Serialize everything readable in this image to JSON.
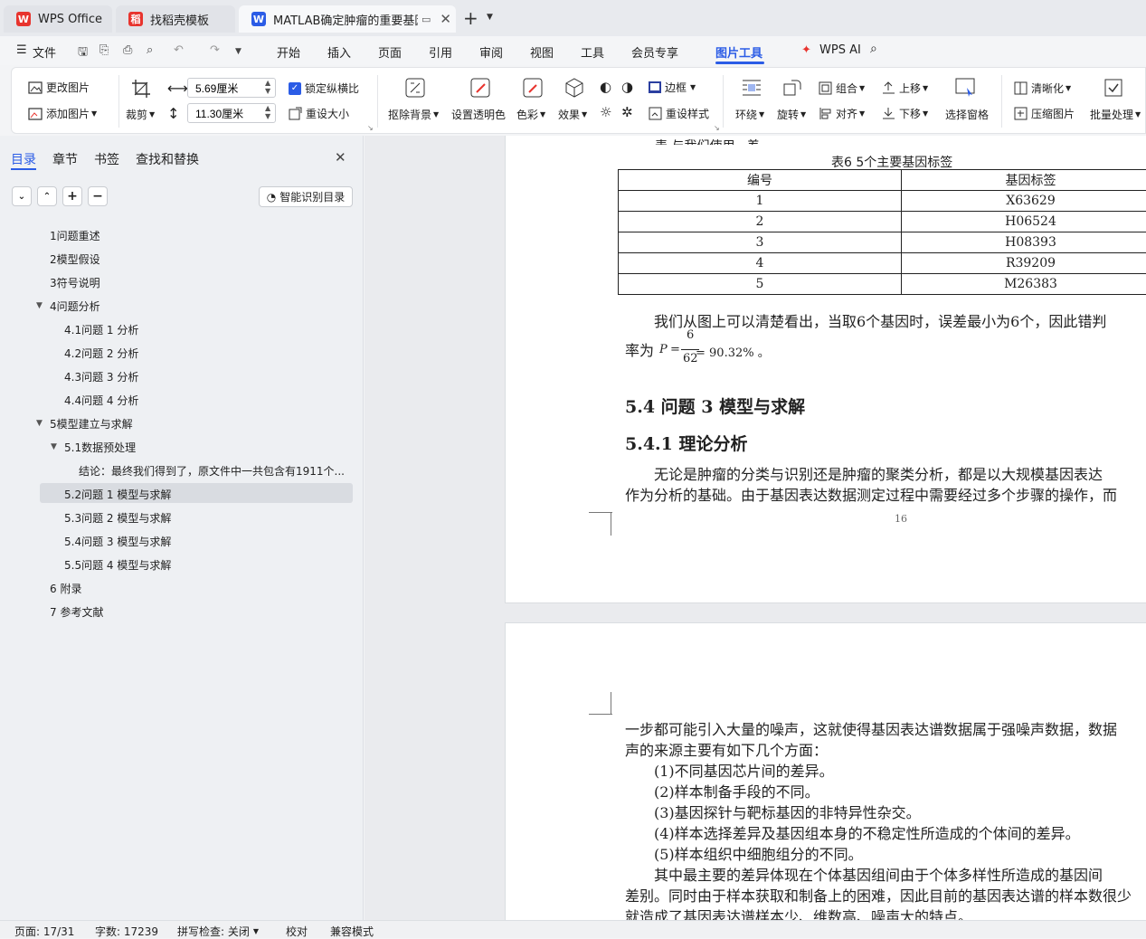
{
  "tabs": [
    {
      "label": "WPS Office",
      "icon": "wps-logo-icon"
    },
    {
      "label": "找稻壳模板",
      "icon": "docer-icon"
    },
    {
      "label": "MATLAB确定肿瘤的重要基因",
      "icon": "writer-doc-icon"
    }
  ],
  "menu": {
    "file": "文件",
    "items": [
      "开始",
      "插入",
      "页面",
      "引用",
      "审阅",
      "视图",
      "工具",
      "会员专享",
      "图片工具"
    ],
    "active": "图片工具",
    "ai": "WPS AI"
  },
  "ribbon": {
    "change_image": "更改图片",
    "add_image": "添加图片",
    "crop": "裁剪",
    "width": "5.69厘米",
    "height": "11.30厘米",
    "lock_ratio": "锁定纵横比",
    "reset_size": "重设大小",
    "remove_bg": "抠除背景",
    "set_transparent": "设置透明色",
    "color": "色彩",
    "effect": "效果",
    "border": "边框",
    "reset_style": "重设样式",
    "wrap": "环绕",
    "rotate": "旋转",
    "group": "组合",
    "align": "对齐",
    "bring_forward": "上移",
    "send_backward": "下移",
    "selection_pane": "选择窗格",
    "sharpen": "清晰化",
    "compress": "压缩图片",
    "batch": "批量处理"
  },
  "sidebar": {
    "tabs": [
      "目录",
      "章节",
      "书签",
      "查找和替换"
    ],
    "smart_toc": "智能识别目录",
    "toc": [
      {
        "label": "1问题重述",
        "level": 1
      },
      {
        "label": "2模型假设",
        "level": 1
      },
      {
        "label": "3符号说明",
        "level": 1
      },
      {
        "label": "4问题分析",
        "level": 1,
        "expanded": true
      },
      {
        "label": "4.1问题 1 分析",
        "level": 2
      },
      {
        "label": "4.2问题 2 分析",
        "level": 2
      },
      {
        "label": "4.3问题 3 分析",
        "level": 2
      },
      {
        "label": "4.4问题 4 分析",
        "level": 2
      },
      {
        "label": "5模型建立与求解",
        "level": 1,
        "expanded": true
      },
      {
        "label": "5.1数据预处理",
        "level": 2,
        "expanded": true
      },
      {
        "label": "结论：最终我们得到了，原文件中一共包含有1911个...",
        "level": 3
      },
      {
        "label": "5.2问题 1 模型与求解",
        "level": 2,
        "selected": true
      },
      {
        "label": "5.3问题 2 模型与求解",
        "level": 2
      },
      {
        "label": "5.4问题 3 模型与求解",
        "level": 2
      },
      {
        "label": "5.5问题 4 模型与求解",
        "level": 2
      },
      {
        "label": "6 附录",
        "level": 1
      },
      {
        "label": "7 参考文献",
        "level": 1
      }
    ]
  },
  "document": {
    "top_fragment": "表 与我们使用...差",
    "table_caption": "表6   5个主要基因标签",
    "table_headers": [
      "编号",
      "基因标签"
    ],
    "table_rows": [
      [
        "1",
        "X63629"
      ],
      [
        "2",
        "H06524"
      ],
      [
        "3",
        "H08393"
      ],
      [
        "4",
        "R39209"
      ],
      [
        "5",
        "M26383"
      ]
    ],
    "para1_line1": "我们从图上可以清楚看出，当取6个基因时，误差最小为6个，因此错判",
    "para1_prefix": "率为",
    "formula_var": "P",
    "formula_num": "6",
    "formula_den": "62",
    "formula_result": "= 90.32% 。",
    "h2": "5.4  问题 3 模型与求解",
    "h3": "5.4.1  理论分析",
    "para2_line1": "无论是肿瘤的分类与识别还是肿瘤的聚类分析，都是以大规模基因表达",
    "para2_line2": "作为分析的基础。由于基因表达数据测定过程中需要经过多个步骤的操作，而",
    "page_number": "16",
    "p2_line1": "一步都可能引入大量的噪声，这就使得基因表达谱数据属于强噪声数据，数据",
    "p2_line2": "声的来源主要有如下几个方面：",
    "p2_items": [
      "(1)不同基因芯片间的差异。",
      "(2)样本制备手段的不同。",
      "(3)基因探针与靶标基因的非特异性杂交。",
      "(4)样本选择差异及基因组本身的不稳定性所造成的个体间的差异。",
      "(5)样本组织中细胞组分的不同。"
    ],
    "p2_line3": "其中最主要的差异体现在个体基因组间由于个体多样性所造成的基因间",
    "p2_line4": "差别。同时由于样本获取和制备上的困难，因此目前的基因表达谱的样本数很少",
    "p2_line5": "就造成了基因表达谱样本少、维数高、噪声大的特点。"
  },
  "status": {
    "page": "页面: 17/31",
    "words": "字数: 17239",
    "spell": "拼写检查: 关闭",
    "proof": "校对",
    "compat": "兼容模式"
  },
  "colors": {
    "accent": "#2b5ce6",
    "wps_red": "#e8342e",
    "selected_bg": "#d9dce1"
  }
}
